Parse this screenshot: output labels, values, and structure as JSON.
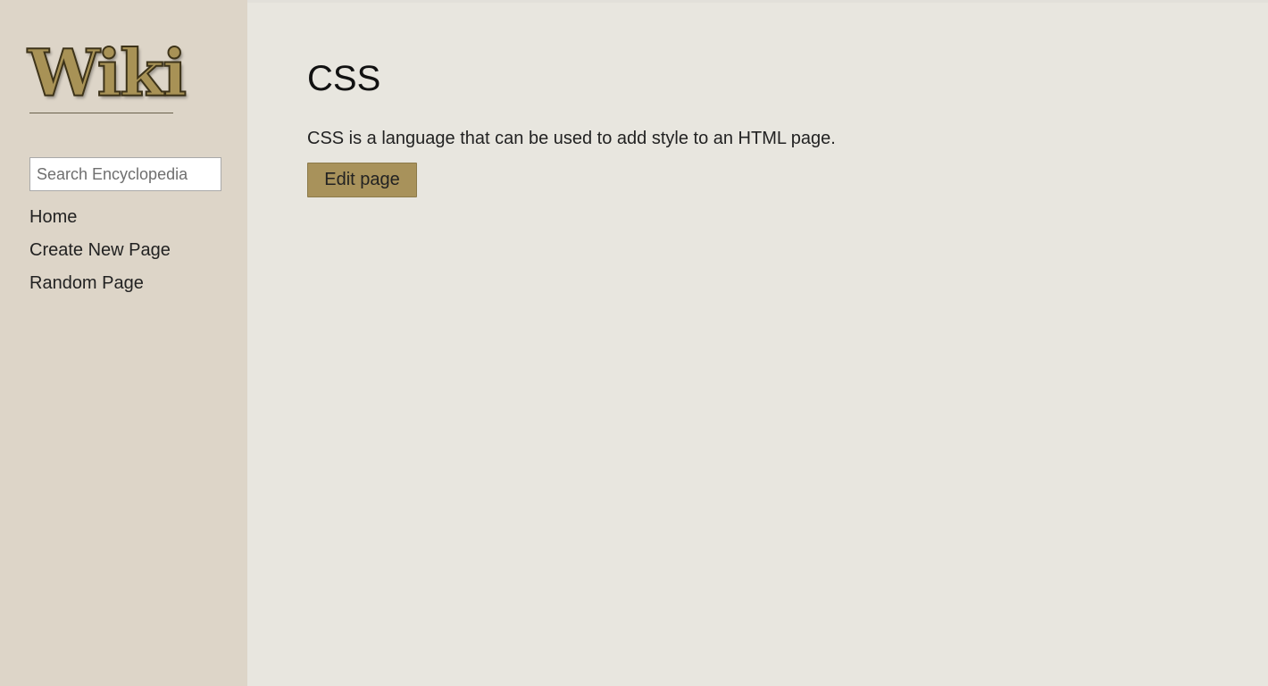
{
  "sidebar": {
    "logo_text": "Wiki",
    "search": {
      "placeholder": "Search Encyclopedia",
      "value": ""
    },
    "nav_items": [
      {
        "label": "Home"
      },
      {
        "label": "Create New Page"
      },
      {
        "label": "Random Page"
      }
    ]
  },
  "main": {
    "title": "CSS",
    "body": "CSS is a language that can be used to add style to an HTML page.",
    "edit_button_label": "Edit page"
  },
  "colors": {
    "sidebar_bg": "#ddd5c8",
    "main_bg": "#e8e6df",
    "accent": "#a8925b",
    "logo_fill": "#a89256"
  }
}
